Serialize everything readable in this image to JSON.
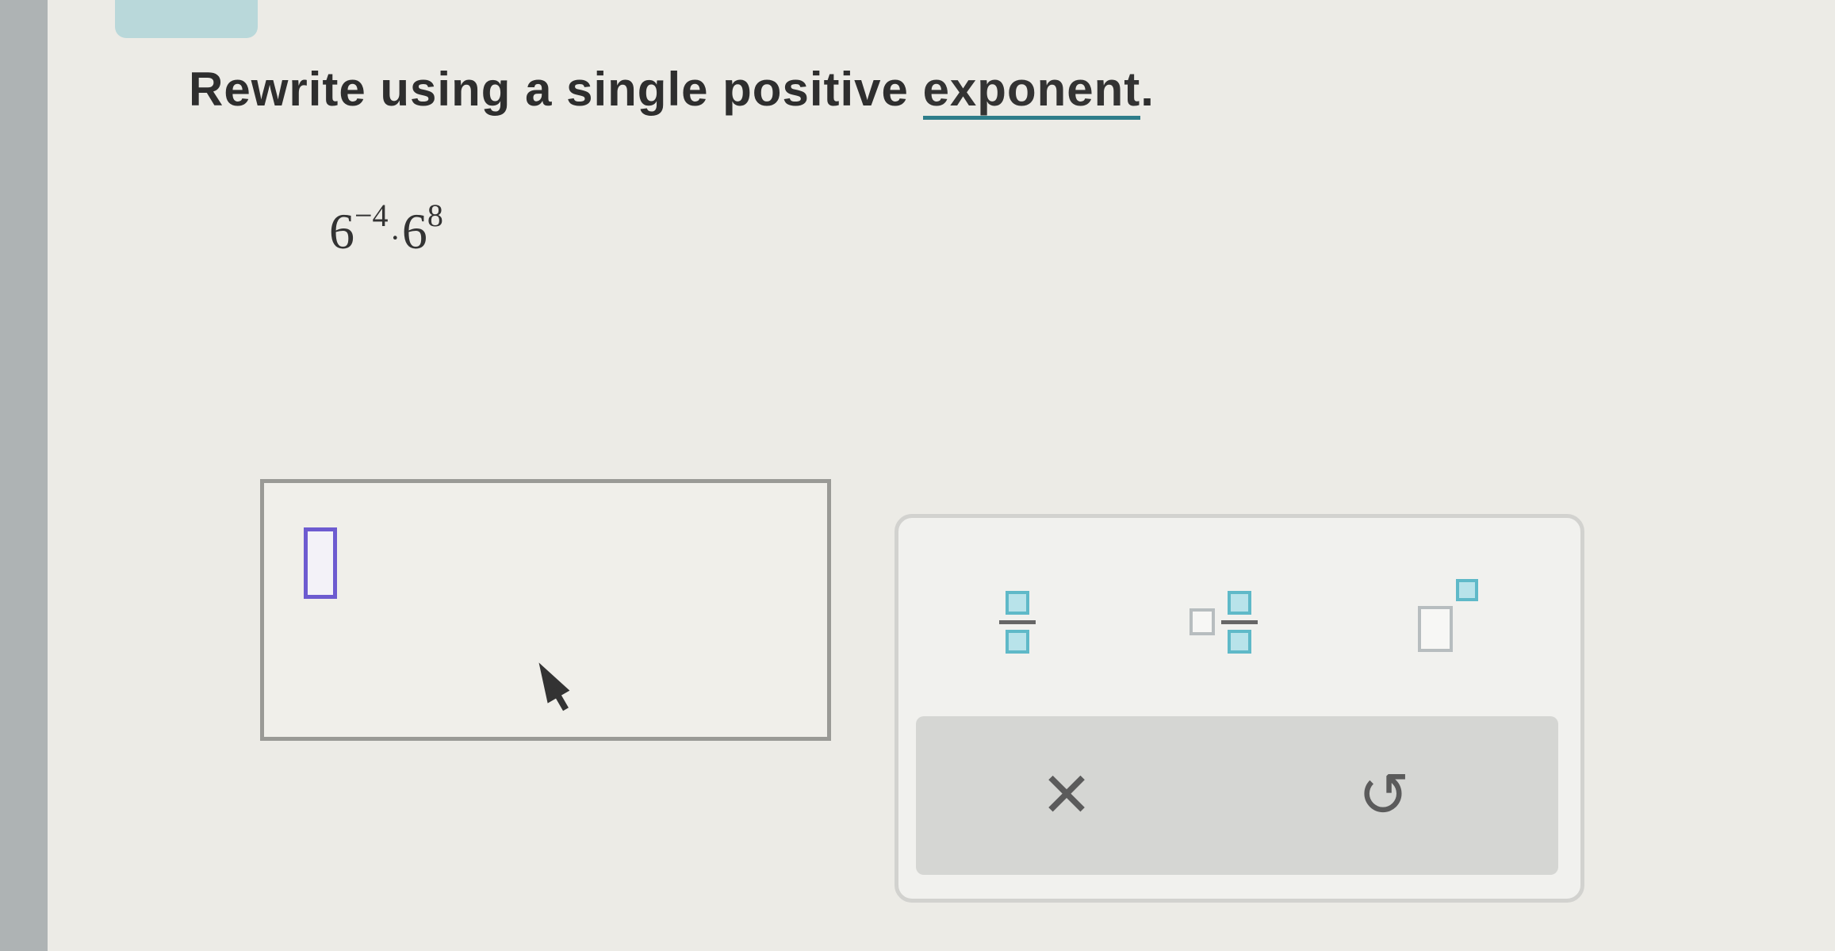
{
  "question": {
    "prompt_prefix": "Rewrite using a single positive ",
    "prompt_link": "exponent",
    "prompt_suffix": "."
  },
  "expression": {
    "base1": "6",
    "exp1": "−4",
    "operator": "·",
    "base2": "6",
    "exp2": "8"
  },
  "answer": {
    "value": ""
  },
  "palette": {
    "tools": [
      "fraction",
      "mixed-number",
      "exponent"
    ],
    "clear_glyph": "✕",
    "undo_glyph": "↺"
  },
  "colors": {
    "link_underline": "#2e7d8a",
    "input_focus": "#6d5bd0",
    "tool_accent": "#5fb9c8"
  }
}
